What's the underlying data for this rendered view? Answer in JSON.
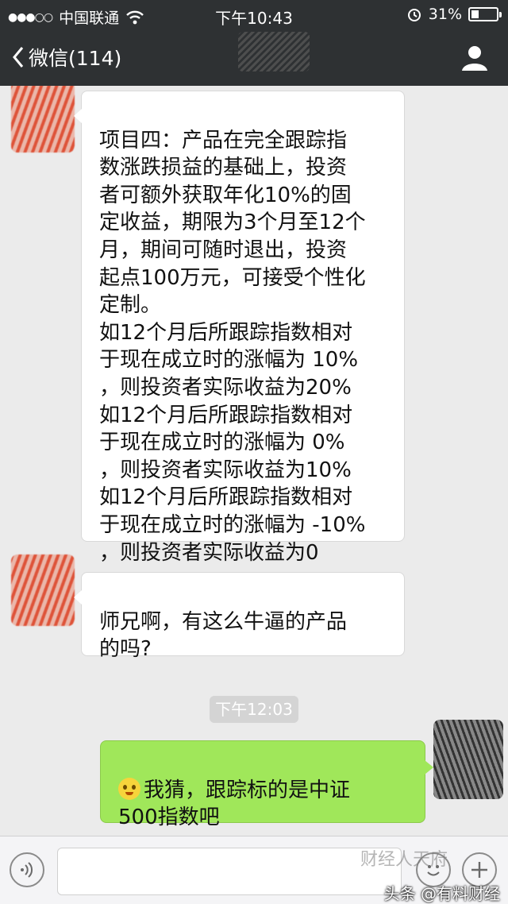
{
  "status_bar": {
    "signal_dots": "●●●○○",
    "carrier": "中国联通",
    "time": "下午10:43",
    "battery": "31%",
    "battery_level": 0.31,
    "icons": [
      "wifi-icon",
      "alarm-icon",
      "battery-icon"
    ]
  },
  "nav": {
    "back_label": "微信(114)",
    "back_icon": "chevron-left-icon",
    "profile_icon": "user-icon"
  },
  "messages": [
    {
      "side": "left",
      "text": "项目四：产品在完全跟踪指\n数涨跌损益的基础上，投资\n者可额外获取年化10%的固\n定收益，期限为3个月至12个\n月，期间可随时退出，投资\n起点100万元，可接受个性化\n定制。\n如12个月后所跟踪指数相对\n于现在成立时的涨幅为 10%\n，则投资者实际收益为20%\n如12个月后所跟踪指数相对\n于现在成立时的涨幅为 0%\n，则投资者实际收益为10%\n如12个月后所跟踪指数相对\n于现在成立时的涨幅为 -10%\n，则投资者实际收益为0"
    },
    {
      "side": "left",
      "text": "师兄啊，有这么牛逼的产品\n的吗?"
    },
    {
      "side": "right",
      "text": "我猜，跟踪标的是中证\n500指数吧",
      "emoji": "thinking-emoji"
    }
  ],
  "timestamp": "下午12:03",
  "input_bar": {
    "voice_icon": "voice-icon",
    "emoji_icon": "smiley-icon",
    "plus_icon": "plus-icon"
  },
  "watermarks": {
    "main": "头条 @有料财经",
    "faded": "财经人天府"
  },
  "colors": {
    "header_bg": "#2e3133",
    "chat_bg": "#ebebeb",
    "sent_bubble": "#a0e75a"
  }
}
